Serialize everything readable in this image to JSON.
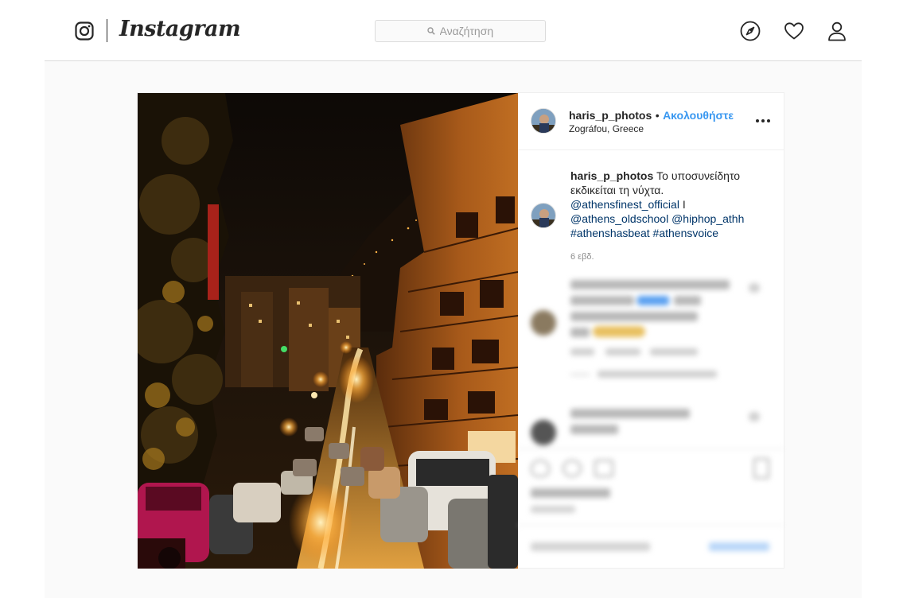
{
  "header": {
    "brand": "Instagram",
    "search_placeholder": "Αναζήτηση",
    "icons": [
      "compass-icon",
      "heart-icon",
      "profile-icon"
    ]
  },
  "post": {
    "username": "haris_p_photos",
    "separator": "•",
    "follow_label": "Ακολουθήστε",
    "location": "Zográfou, Greece",
    "caption": {
      "username": "haris_p_photos",
      "text": "Το υποσυνείδητο εκδικείται τη νύχτα.",
      "mention1": "@athensfinest_official",
      "sep": "I",
      "mention2": "@athens_oldschool",
      "mention3": "@hiphop_athh",
      "hashtag1": "#athenshasbeat",
      "hashtag2": "#athensvoice"
    },
    "time": "6 εβδ."
  },
  "colors": {
    "link": "#003569",
    "follow": "#3897f0",
    "border": "#dbdbdb",
    "background": "#fafafa"
  }
}
